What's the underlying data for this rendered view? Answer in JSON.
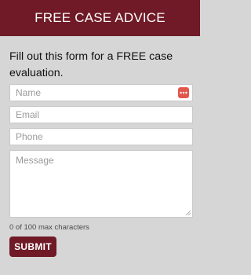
{
  "header": {
    "title": "FREE CASE ADVICE"
  },
  "form": {
    "intro": "Fill out this form for a FREE case evaluation.",
    "name_placeholder": "Name",
    "email_placeholder": "Email",
    "phone_placeholder": "Phone",
    "message_placeholder": "Message",
    "char_counter": "0 of 100 max characters",
    "submit_label": "SUBMIT"
  },
  "icons": {
    "autofill": "password-manager-autofill-icon",
    "resize": "resize-grip-icon"
  },
  "colors": {
    "brand": "#6f1a26",
    "background": "#d6d6d6",
    "autofill_icon": "#e2574c"
  }
}
